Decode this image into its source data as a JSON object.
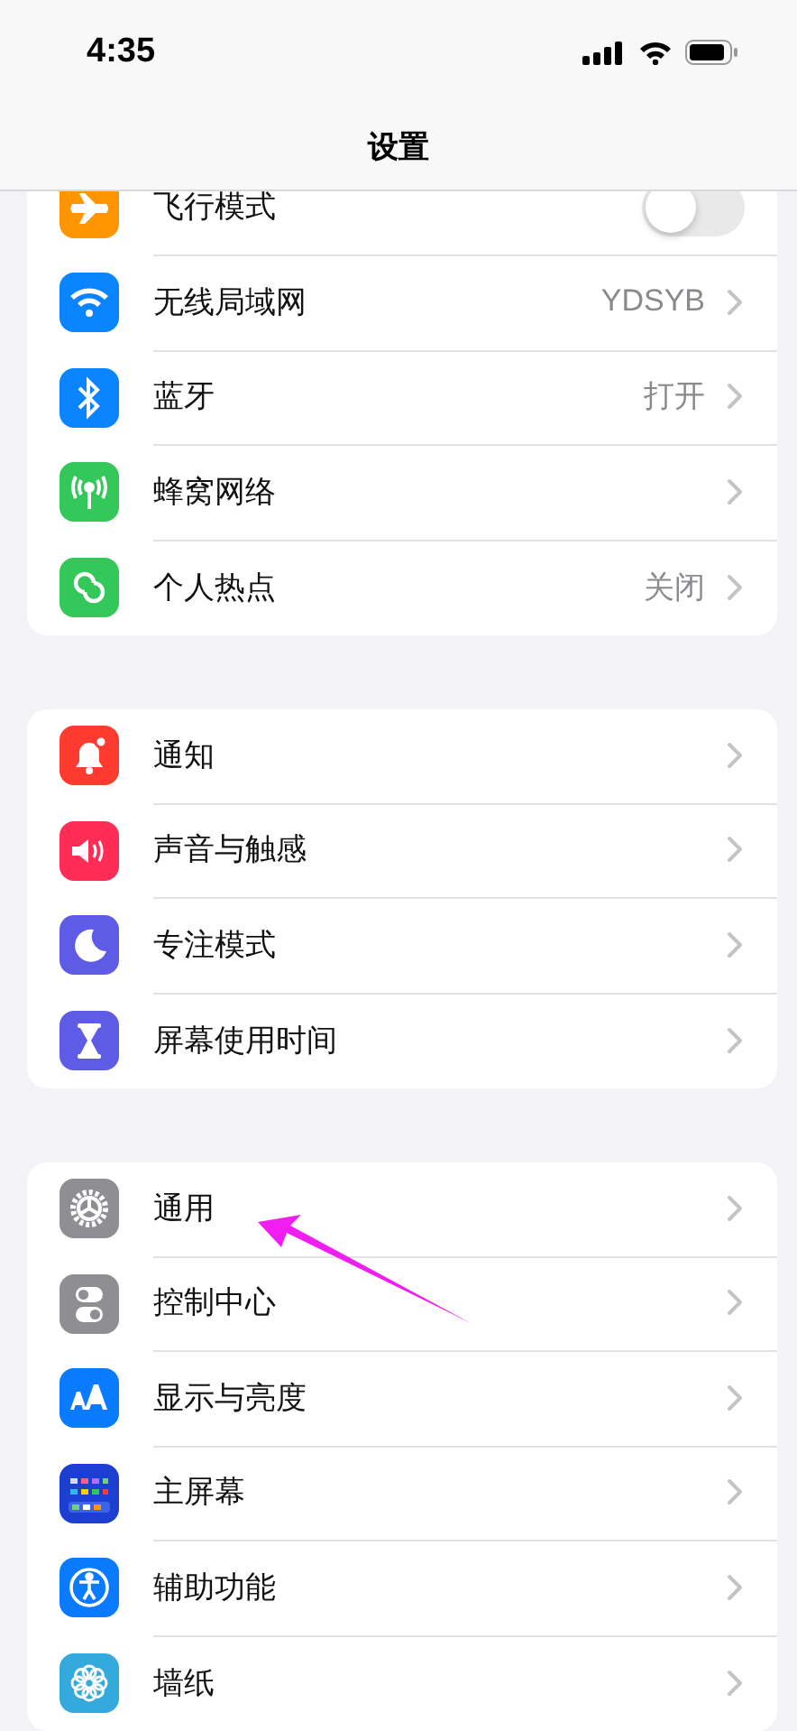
{
  "status_bar": {
    "time": "4:35"
  },
  "nav": {
    "title": "设置"
  },
  "groups": [
    {
      "rows": [
        {
          "kind": "toggle",
          "label": "飞行模式",
          "color": "#ff9500",
          "on": false
        },
        {
          "kind": "link",
          "label": "无线局域网",
          "value": "YDSYB",
          "color": "#0a84ff"
        },
        {
          "kind": "link",
          "label": "蓝牙",
          "value": "打开",
          "color": "#0a84ff"
        },
        {
          "kind": "link",
          "label": "蜂窝网络",
          "color": "#34c759"
        },
        {
          "kind": "link",
          "label": "个人热点",
          "value": "关闭",
          "color": "#34c759"
        }
      ]
    },
    {
      "rows": [
        {
          "kind": "link",
          "label": "通知",
          "color": "#ff3b30"
        },
        {
          "kind": "link",
          "label": "声音与触感",
          "color": "#ff2d55"
        },
        {
          "kind": "link",
          "label": "专注模式",
          "color": "#5e5ce6"
        },
        {
          "kind": "link",
          "label": "屏幕使用时间",
          "color": "#5e5ce6"
        }
      ]
    },
    {
      "rows": [
        {
          "kind": "link",
          "label": "通用",
          "color": "#8e8e93"
        },
        {
          "kind": "link",
          "label": "控制中心",
          "color": "#8e8e93"
        },
        {
          "kind": "link",
          "label": "显示与亮度",
          "color": "#0a7aff"
        },
        {
          "kind": "link",
          "label": "主屏幕",
          "color": "#1c3fd1"
        },
        {
          "kind": "link",
          "label": "辅助功能",
          "color": "#0a7aff"
        },
        {
          "kind": "link",
          "label": "墙纸",
          "color": "#34aadc"
        }
      ]
    }
  ]
}
